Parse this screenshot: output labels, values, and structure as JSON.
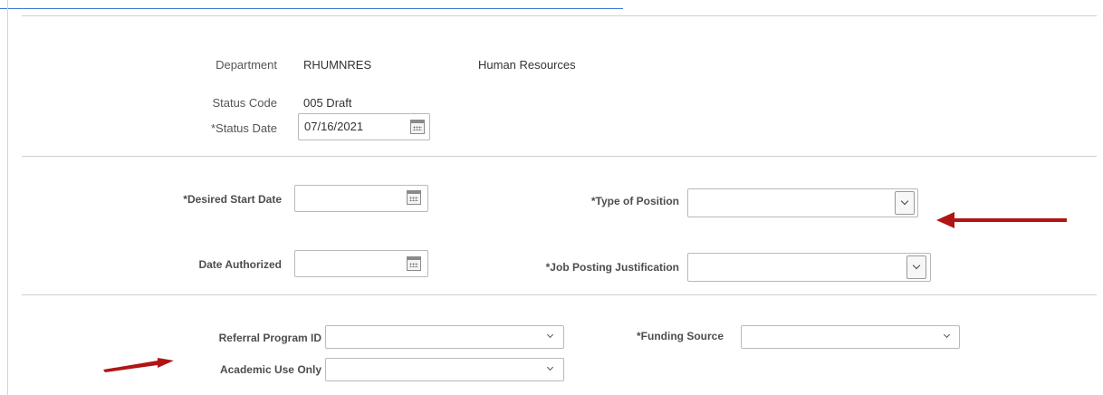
{
  "colors": {
    "annotation_arrow": "#b01515",
    "link_underline": "#3a7bd5",
    "divider": "#cfcfcf"
  },
  "header": {
    "department_label": "Department",
    "department_code": "RHUMNRES",
    "department_name": "Human Resources",
    "status_code_label": "Status Code",
    "status_code_value": "005 Draft",
    "status_date_label": "*Status Date",
    "status_date_value": "07/16/2021"
  },
  "position": {
    "desired_start_label": "*Desired Start Date",
    "desired_start_value": "",
    "date_authorized_label": "Date Authorized",
    "date_authorized_value": "",
    "type_of_position_label": "*Type of Position",
    "type_of_position_value": "",
    "job_posting_label": "*Job Posting Justification",
    "job_posting_value": ""
  },
  "program": {
    "referral_label": "Referral Program ID",
    "referral_value": "",
    "academic_label": "Academic Use Only",
    "academic_value": "",
    "funding_label": "*Funding Source",
    "funding_value": ""
  },
  "icons": {
    "calendar": "calendar-icon",
    "dropdown": "chevron-down-icon",
    "arrow": "arrow-icon"
  }
}
